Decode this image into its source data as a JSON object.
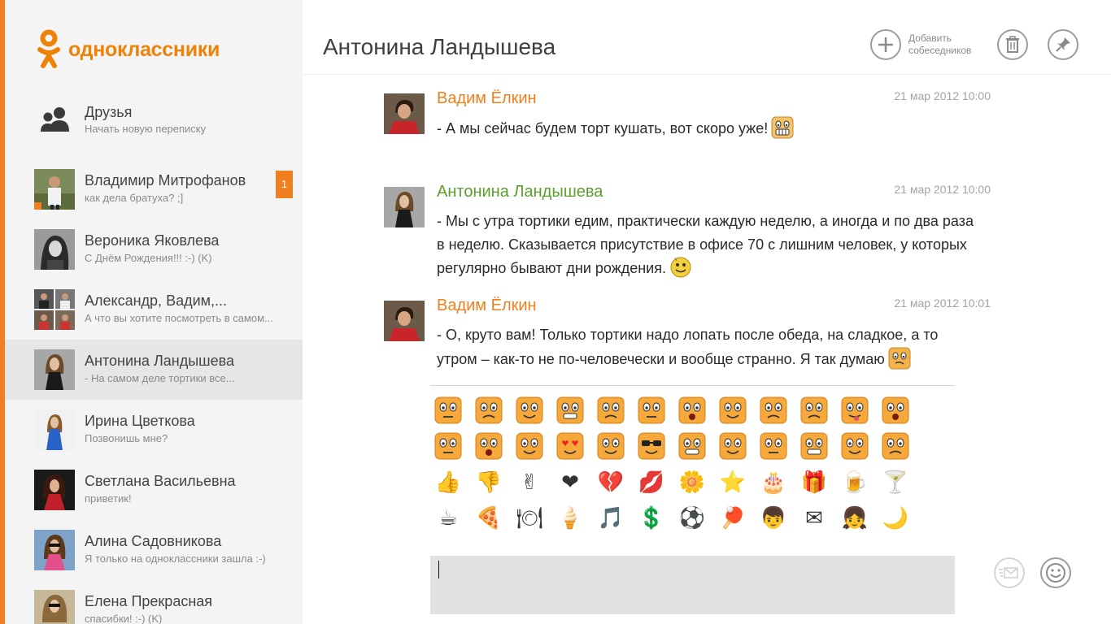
{
  "app": {
    "logo_text": "одноклассники",
    "accent": "#f07f1f"
  },
  "sidebar": {
    "friends": {
      "title": "Друзья",
      "subtitle": "Начать новую переписку"
    },
    "contacts": [
      {
        "name": "Владимир Митрофанов",
        "preview": "как дела братуха? ;]",
        "unread": "1",
        "online": true
      },
      {
        "name": "Вероника Яковлева",
        "preview": "С Днём Рождения!!! :-) (K)"
      },
      {
        "name": "Александр, Вадим,...",
        "preview": "А что вы хотите посмотреть в самом..."
      },
      {
        "name": "Антонина Ландышева",
        "preview": "- На самом деле тортики все...",
        "active": true
      },
      {
        "name": "Ирина Цветкова",
        "preview": "Позвонишь мне?"
      },
      {
        "name": "Светлана Васильевна",
        "preview": "приветик!"
      },
      {
        "name": "Алина Садовникова",
        "preview": "Я только на одноклассники зашла :-)"
      },
      {
        "name": "Елена Прекрасная",
        "preview": "спасибки! :-) (K)"
      }
    ]
  },
  "header": {
    "title": "Антонина Ландышева",
    "add_label_line1": "Добавить",
    "add_label_line2": "собеседников"
  },
  "messages": [
    {
      "author": "Вадим Ёлкин",
      "time": "21 мар 2012 10:00",
      "text": "- А мы сейчас будем торт кушать, вот скоро уже!"
    },
    {
      "author": "Антонина Ландышева",
      "time": "21 мар 2012 10:00",
      "text": "- Мы с утра тортики едим, практически каждую неделю, а иногда и по два раза в неделю. Сказывается присутствие в офисе 70 с лишним человек, у которых регулярно бывают дни рождения."
    },
    {
      "author": "Вадим Ёлкин",
      "time": "21 мар 2012 10:01",
      "text": "- О, круто вам! Только тортики надо лопать после обеда, на сладкое, а то утром – как-то не по-человечески и вообще странно. Я так думаю"
    }
  ],
  "emoticons": {
    "row3": [
      "👍",
      "👎",
      "✌",
      "❤",
      "💔",
      "💋",
      "🌼",
      "⭐",
      "🎂",
      "🎁",
      "🍺",
      "🍸"
    ],
    "row4": [
      "☕",
      "🍕",
      "🍽",
      "🍦",
      "🎵",
      "💲",
      "⚽",
      "🏓",
      "👦",
      "✉",
      "👧",
      "🌙"
    ]
  }
}
